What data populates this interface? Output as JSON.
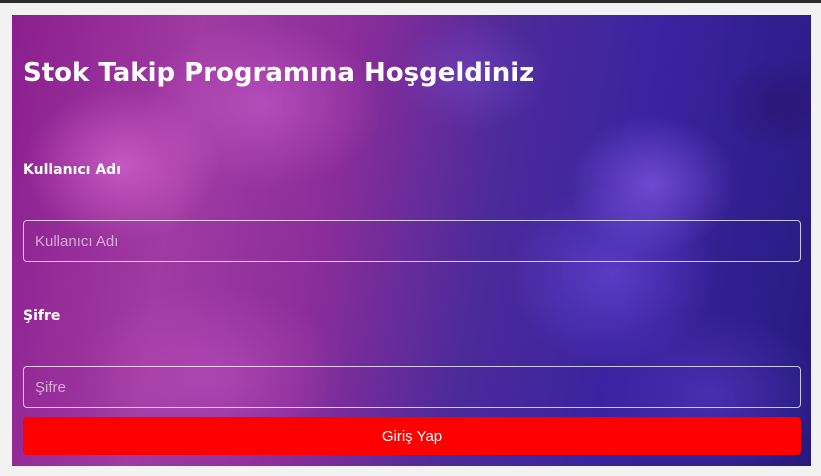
{
  "page": {
    "title": "Stok Takip Programına Hoşgeldiniz"
  },
  "form": {
    "username_label": "Kullanıcı Adı",
    "username_placeholder": "Kullanıcı Adı",
    "username_value": "",
    "password_label": "Şifre",
    "password_placeholder": "Şifre",
    "password_value": "",
    "submit_label": "Giriş Yap"
  },
  "colors": {
    "submit_button": "#ff0000",
    "text": "#ffffff",
    "background_left": "#8a1f8e",
    "background_right": "#271a7e"
  }
}
